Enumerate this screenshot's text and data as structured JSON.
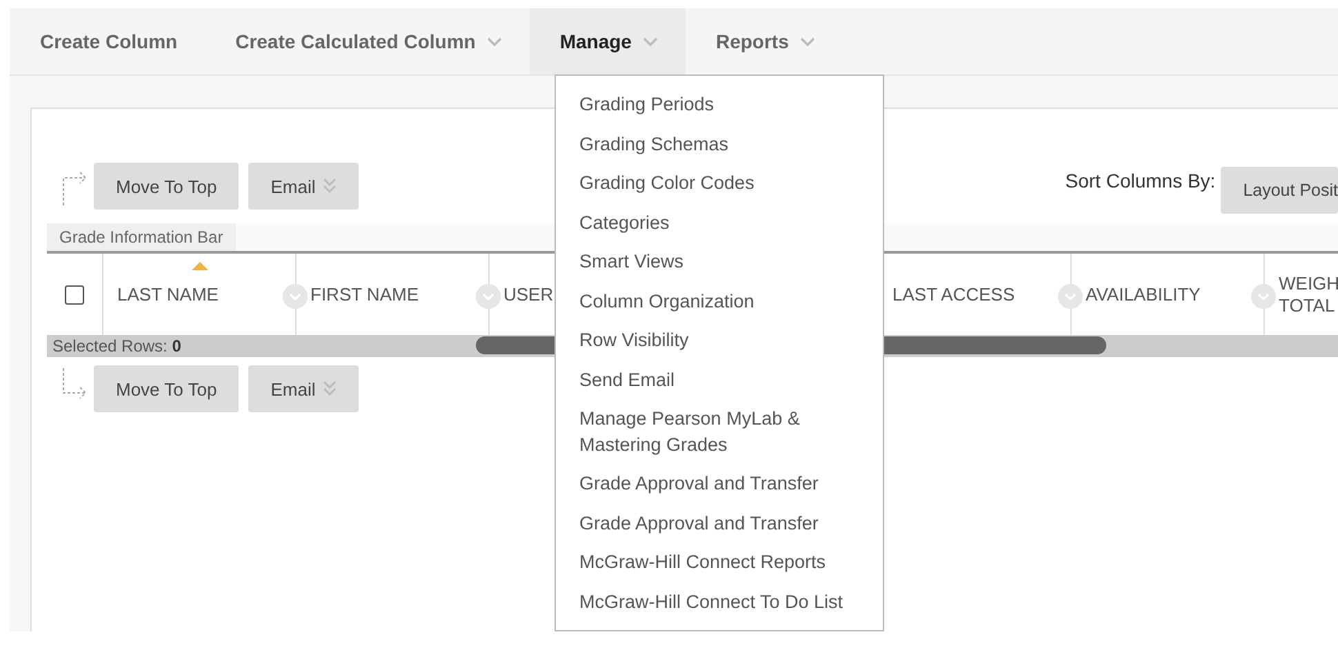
{
  "nav": [
    {
      "label": "Create Column",
      "dropdown": false,
      "selected": false
    },
    {
      "label": "Create Calculated Column",
      "dropdown": true,
      "selected": false
    },
    {
      "label": "Manage",
      "dropdown": true,
      "selected": true
    },
    {
      "label": "Reports",
      "dropdown": true,
      "selected": false
    }
  ],
  "manage_menu": [
    "Grading Periods",
    "Grading Schemas",
    "Grading Color Codes",
    "Categories",
    "Smart Views",
    "Column Organization",
    "Row Visibility",
    "Send Email",
    "Manage Pearson MyLab & Mastering Grades",
    "Grade Approval and Transfer",
    "Grade Approval and Transfer",
    "McGraw-Hill Connect Reports",
    "McGraw-Hill Connect To Do List"
  ],
  "top_actions": [
    {
      "label": "Move To Top",
      "dropdown": false
    },
    {
      "label": "Email",
      "dropdown": true
    }
  ],
  "sort": {
    "label": "Sort Columns By:",
    "value": "Layout Posit"
  },
  "info_bar": "Grade Information Bar",
  "select_all": {
    "checked": false
  },
  "columns": [
    {
      "label": "LAST NAME",
      "sorted": true,
      "menu": true
    },
    {
      "label": "FIRST NAME",
      "sorted": false,
      "menu": true
    },
    {
      "label": "USER",
      "sorted": false,
      "menu": false
    },
    {
      "label": "LAST ACCESS",
      "sorted": false,
      "menu": true
    },
    {
      "label": "AVAILABILITY",
      "sorted": false,
      "menu": true
    },
    {
      "label": "WEIGH TOTAL",
      "sorted": false,
      "menu": false
    }
  ],
  "selected_rows": "Selected Rows: **0**",
  "bottom_actions": [
    {
      "label": "Move To Top",
      "dropdown": false
    },
    {
      "label": "Email",
      "dropdown": true
    }
  ]
}
